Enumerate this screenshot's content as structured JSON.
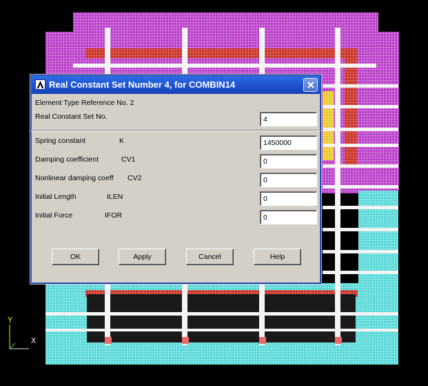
{
  "dialog": {
    "title": "Real Constant Set Number 4, for COMBIN14",
    "element_type_ref": "Element Type Reference No. 2",
    "rows": [
      {
        "label": "Real Constant Set No.",
        "symbol": "",
        "value": "4"
      },
      {
        "label": "Spring constant",
        "symbol": "K",
        "value": "1450000"
      },
      {
        "label": "Damping coefficient",
        "symbol": "CV1",
        "value": "0"
      },
      {
        "label": "Nonlinear damping coeff",
        "symbol": "CV2",
        "value": "0"
      },
      {
        "label": "Initial Length",
        "symbol": "ILEN",
        "value": "0"
      },
      {
        "label": "Initial Force",
        "symbol": "IFOR",
        "value": "0"
      }
    ],
    "buttons": {
      "ok": "OK",
      "apply": "Apply",
      "cancel": "Cancel",
      "help": "Help"
    }
  },
  "triad": {
    "x_label": "X",
    "y_label": "Y"
  },
  "colors": {
    "background": "#000000",
    "mesh_magenta": "#b83cc8",
    "mesh_cyan": "#54d8d8",
    "mesh_red": "#c83228",
    "mesh_yellow": "#e8c828",
    "titlebar": "#2259d6",
    "dialog_face": "#d4d0c8"
  }
}
